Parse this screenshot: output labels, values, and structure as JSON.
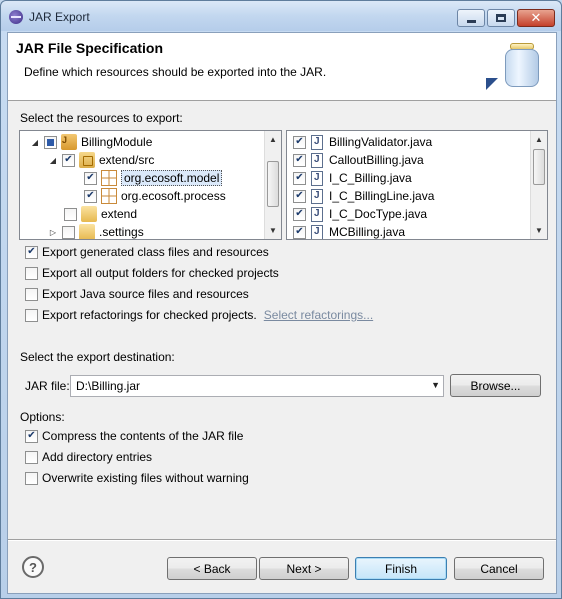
{
  "window": {
    "title": "JAR Export"
  },
  "header": {
    "title": "JAR File Specification",
    "description": "Define which resources should be exported into the JAR."
  },
  "resources": {
    "label": "Select the resources to export:",
    "tree": [
      {
        "label": "BillingModule",
        "state": "partial",
        "expanded": true
      },
      {
        "label": "extend/src",
        "state": "checked",
        "expanded": true
      },
      {
        "label": "org.ecosoft.model",
        "state": "checked",
        "selected": true
      },
      {
        "label": "org.ecosoft.process",
        "state": "checked"
      },
      {
        "label": "extend",
        "state": "unchecked"
      },
      {
        "label": ".settings",
        "state": "unchecked",
        "expanded": false
      }
    ],
    "files": [
      {
        "label": "BillingValidator.java",
        "checked": true
      },
      {
        "label": "CalloutBilling.java",
        "checked": true
      },
      {
        "label": "I_C_Billing.java",
        "checked": true
      },
      {
        "label": "I_C_BillingLine.java",
        "checked": true
      },
      {
        "label": "I_C_DocType.java",
        "checked": true
      },
      {
        "label": "MCBilling.java",
        "checked": true
      }
    ]
  },
  "export_options": [
    {
      "label": "Export generated class files and resources",
      "checked": true
    },
    {
      "label": "Export all output folders for checked projects",
      "checked": false
    },
    {
      "label": "Export Java source files and resources",
      "checked": false
    },
    {
      "label": "Export refactorings for checked projects.",
      "checked": false,
      "link": "Select refactorings..."
    }
  ],
  "destination": {
    "label": "Select the export destination:",
    "jar_label": "JAR file:",
    "jar_value": "D:\\Billing.jar",
    "browse": "Browse..."
  },
  "options": {
    "label": "Options:",
    "items": [
      {
        "label": "Compress the contents of the JAR file",
        "checked": true
      },
      {
        "label": "Add directory entries",
        "checked": false
      },
      {
        "label": "Overwrite existing files without warning",
        "checked": false
      }
    ]
  },
  "buttons": {
    "help": "?",
    "back": "< Back",
    "next": "Next >",
    "finish": "Finish",
    "cancel": "Cancel"
  },
  "colors": {
    "link": "#7a8aa0",
    "accent": "#3c7fb1",
    "selection": "#dbe9fa"
  }
}
